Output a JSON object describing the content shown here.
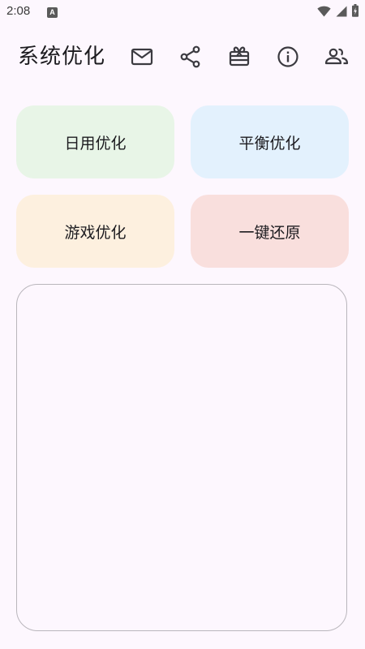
{
  "status_bar": {
    "time": "2:08",
    "notification_icon_letter": "A"
  },
  "app_bar": {
    "title": "系统优化"
  },
  "buttons": {
    "daily": {
      "label": "日用优化",
      "color": "#e8f5e7"
    },
    "balanced": {
      "label": "平衡优化",
      "color": "#e3f1fd"
    },
    "game": {
      "label": "游戏优化",
      "color": "#fdf0df"
    },
    "restore": {
      "label": "一键还原",
      "color": "#f9dfdd"
    }
  },
  "log": {
    "text": ""
  },
  "colors": {
    "background": "#fdf7fe",
    "icon": "#3b3a40",
    "border": "#b9b6bc"
  }
}
